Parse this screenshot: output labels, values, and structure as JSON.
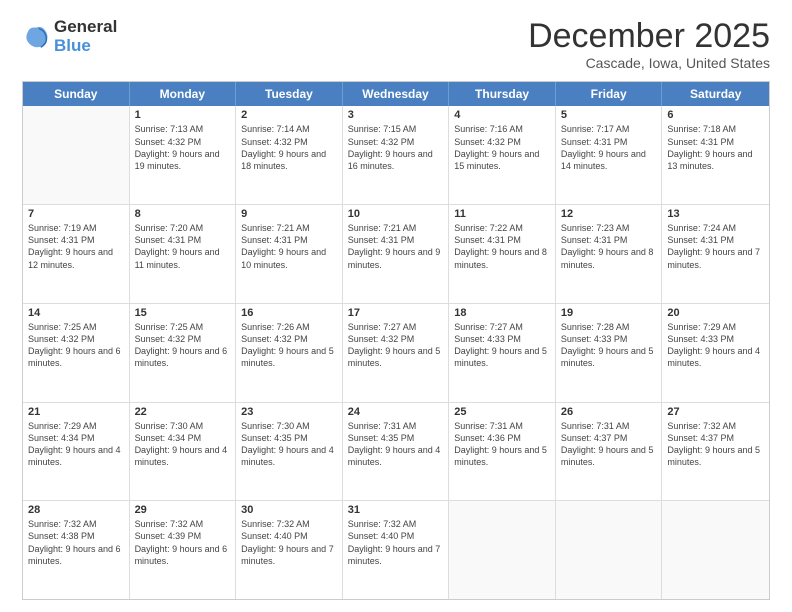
{
  "logo": {
    "general": "General",
    "blue": "Blue"
  },
  "title": "December 2025",
  "subtitle": "Cascade, Iowa, United States",
  "header_days": [
    "Sunday",
    "Monday",
    "Tuesday",
    "Wednesday",
    "Thursday",
    "Friday",
    "Saturday"
  ],
  "weeks": [
    [
      {
        "day": "",
        "sunrise": "",
        "sunset": "",
        "daylight": ""
      },
      {
        "day": "1",
        "sunrise": "Sunrise: 7:13 AM",
        "sunset": "Sunset: 4:32 PM",
        "daylight": "Daylight: 9 hours and 19 minutes."
      },
      {
        "day": "2",
        "sunrise": "Sunrise: 7:14 AM",
        "sunset": "Sunset: 4:32 PM",
        "daylight": "Daylight: 9 hours and 18 minutes."
      },
      {
        "day": "3",
        "sunrise": "Sunrise: 7:15 AM",
        "sunset": "Sunset: 4:32 PM",
        "daylight": "Daylight: 9 hours and 16 minutes."
      },
      {
        "day": "4",
        "sunrise": "Sunrise: 7:16 AM",
        "sunset": "Sunset: 4:32 PM",
        "daylight": "Daylight: 9 hours and 15 minutes."
      },
      {
        "day": "5",
        "sunrise": "Sunrise: 7:17 AM",
        "sunset": "Sunset: 4:31 PM",
        "daylight": "Daylight: 9 hours and 14 minutes."
      },
      {
        "day": "6",
        "sunrise": "Sunrise: 7:18 AM",
        "sunset": "Sunset: 4:31 PM",
        "daylight": "Daylight: 9 hours and 13 minutes."
      }
    ],
    [
      {
        "day": "7",
        "sunrise": "Sunrise: 7:19 AM",
        "sunset": "Sunset: 4:31 PM",
        "daylight": "Daylight: 9 hours and 12 minutes."
      },
      {
        "day": "8",
        "sunrise": "Sunrise: 7:20 AM",
        "sunset": "Sunset: 4:31 PM",
        "daylight": "Daylight: 9 hours and 11 minutes."
      },
      {
        "day": "9",
        "sunrise": "Sunrise: 7:21 AM",
        "sunset": "Sunset: 4:31 PM",
        "daylight": "Daylight: 9 hours and 10 minutes."
      },
      {
        "day": "10",
        "sunrise": "Sunrise: 7:21 AM",
        "sunset": "Sunset: 4:31 PM",
        "daylight": "Daylight: 9 hours and 9 minutes."
      },
      {
        "day": "11",
        "sunrise": "Sunrise: 7:22 AM",
        "sunset": "Sunset: 4:31 PM",
        "daylight": "Daylight: 9 hours and 8 minutes."
      },
      {
        "day": "12",
        "sunrise": "Sunrise: 7:23 AM",
        "sunset": "Sunset: 4:31 PM",
        "daylight": "Daylight: 9 hours and 8 minutes."
      },
      {
        "day": "13",
        "sunrise": "Sunrise: 7:24 AM",
        "sunset": "Sunset: 4:31 PM",
        "daylight": "Daylight: 9 hours and 7 minutes."
      }
    ],
    [
      {
        "day": "14",
        "sunrise": "Sunrise: 7:25 AM",
        "sunset": "Sunset: 4:32 PM",
        "daylight": "Daylight: 9 hours and 6 minutes."
      },
      {
        "day": "15",
        "sunrise": "Sunrise: 7:25 AM",
        "sunset": "Sunset: 4:32 PM",
        "daylight": "Daylight: 9 hours and 6 minutes."
      },
      {
        "day": "16",
        "sunrise": "Sunrise: 7:26 AM",
        "sunset": "Sunset: 4:32 PM",
        "daylight": "Daylight: 9 hours and 5 minutes."
      },
      {
        "day": "17",
        "sunrise": "Sunrise: 7:27 AM",
        "sunset": "Sunset: 4:32 PM",
        "daylight": "Daylight: 9 hours and 5 minutes."
      },
      {
        "day": "18",
        "sunrise": "Sunrise: 7:27 AM",
        "sunset": "Sunset: 4:33 PM",
        "daylight": "Daylight: 9 hours and 5 minutes."
      },
      {
        "day": "19",
        "sunrise": "Sunrise: 7:28 AM",
        "sunset": "Sunset: 4:33 PM",
        "daylight": "Daylight: 9 hours and 5 minutes."
      },
      {
        "day": "20",
        "sunrise": "Sunrise: 7:29 AM",
        "sunset": "Sunset: 4:33 PM",
        "daylight": "Daylight: 9 hours and 4 minutes."
      }
    ],
    [
      {
        "day": "21",
        "sunrise": "Sunrise: 7:29 AM",
        "sunset": "Sunset: 4:34 PM",
        "daylight": "Daylight: 9 hours and 4 minutes."
      },
      {
        "day": "22",
        "sunrise": "Sunrise: 7:30 AM",
        "sunset": "Sunset: 4:34 PM",
        "daylight": "Daylight: 9 hours and 4 minutes."
      },
      {
        "day": "23",
        "sunrise": "Sunrise: 7:30 AM",
        "sunset": "Sunset: 4:35 PM",
        "daylight": "Daylight: 9 hours and 4 minutes."
      },
      {
        "day": "24",
        "sunrise": "Sunrise: 7:31 AM",
        "sunset": "Sunset: 4:35 PM",
        "daylight": "Daylight: 9 hours and 4 minutes."
      },
      {
        "day": "25",
        "sunrise": "Sunrise: 7:31 AM",
        "sunset": "Sunset: 4:36 PM",
        "daylight": "Daylight: 9 hours and 5 minutes."
      },
      {
        "day": "26",
        "sunrise": "Sunrise: 7:31 AM",
        "sunset": "Sunset: 4:37 PM",
        "daylight": "Daylight: 9 hours and 5 minutes."
      },
      {
        "day": "27",
        "sunrise": "Sunrise: 7:32 AM",
        "sunset": "Sunset: 4:37 PM",
        "daylight": "Daylight: 9 hours and 5 minutes."
      }
    ],
    [
      {
        "day": "28",
        "sunrise": "Sunrise: 7:32 AM",
        "sunset": "Sunset: 4:38 PM",
        "daylight": "Daylight: 9 hours and 6 minutes."
      },
      {
        "day": "29",
        "sunrise": "Sunrise: 7:32 AM",
        "sunset": "Sunset: 4:39 PM",
        "daylight": "Daylight: 9 hours and 6 minutes."
      },
      {
        "day": "30",
        "sunrise": "Sunrise: 7:32 AM",
        "sunset": "Sunset: 4:40 PM",
        "daylight": "Daylight: 9 hours and 7 minutes."
      },
      {
        "day": "31",
        "sunrise": "Sunrise: 7:32 AM",
        "sunset": "Sunset: 4:40 PM",
        "daylight": "Daylight: 9 hours and 7 minutes."
      },
      {
        "day": "",
        "sunrise": "",
        "sunset": "",
        "daylight": ""
      },
      {
        "day": "",
        "sunrise": "",
        "sunset": "",
        "daylight": ""
      },
      {
        "day": "",
        "sunrise": "",
        "sunset": "",
        "daylight": ""
      }
    ]
  ]
}
